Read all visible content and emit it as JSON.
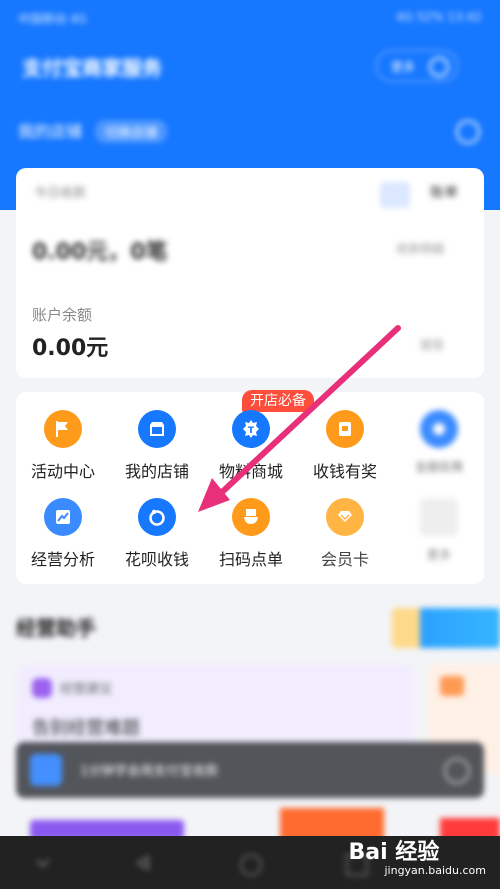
{
  "status_bar": {
    "time": "中国移动 4G",
    "right": "4G 52% 13:42"
  },
  "header": {
    "title": "支付宝商家服务",
    "pill_text": "更多",
    "store_name": "我的店铺",
    "store_tag": "切换店铺"
  },
  "summary": {
    "today_label": "今日收款",
    "tab_a": "",
    "tab_b": "账单",
    "income_text": "0.00元，0笔",
    "income_link": "收款明细",
    "balance_label": "账户余额",
    "balance_value": "0.00元",
    "balance_link": "提现"
  },
  "grid": {
    "badge": "开店必备",
    "items": [
      {
        "label": "活动中心",
        "icon": "flag-icon",
        "color": "#ff9a1a"
      },
      {
        "label": "我的店铺",
        "icon": "store-icon",
        "color": "#1677ff"
      },
      {
        "label": "物料商城",
        "icon": "tshirt-icon",
        "color": "#1677ff"
      },
      {
        "label": "收钱有奖",
        "icon": "gift-icon",
        "color": "#ff9a1a"
      },
      {
        "label": "全部应用",
        "icon": "apps-icon",
        "color": "#3a8bff"
      },
      {
        "label": "经营分析",
        "icon": "chart-icon",
        "color": "#3a8bff"
      },
      {
        "label": "花呗收钱",
        "icon": "huabei-icon",
        "color": "#1677ff"
      },
      {
        "label": "扫码点单",
        "icon": "bowl-icon",
        "color": "#ff9a1a"
      },
      {
        "label": "会员卡",
        "icon": "diamond-icon",
        "color": "#ff9a1a"
      },
      {
        "label": "更多",
        "icon": "more-icon",
        "color": "#eeeeee"
      }
    ]
  },
  "assistant": {
    "title": "经营助手",
    "card_a_tag": "经营建议",
    "card_a_text": "告别经营难题"
  },
  "toast": {
    "text": "1分钟学会用支付宝收款"
  },
  "watermark": {
    "logo": "Bai 经验",
    "sub": "jingyan.baidu.com"
  }
}
